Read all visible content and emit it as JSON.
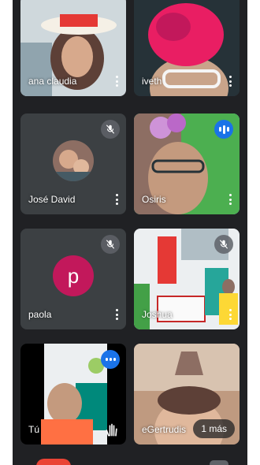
{
  "participants": [
    {
      "name": "ana claudia"
    },
    {
      "name": "iveth"
    },
    {
      "name": "José David"
    },
    {
      "name": "Osiris"
    },
    {
      "name": "paola",
      "initial": "p"
    },
    {
      "name": "Joshua"
    },
    {
      "name": "Tú"
    },
    {
      "name": "eGertrudis"
    }
  ],
  "more_label": "1 más",
  "colors": {
    "background": "#202124",
    "tile": "#3c4043",
    "active_border": "#8ab4f8",
    "speaking": "#1a73e8",
    "avatar_paola": "#c2185b",
    "end_call": "#ea4335"
  }
}
